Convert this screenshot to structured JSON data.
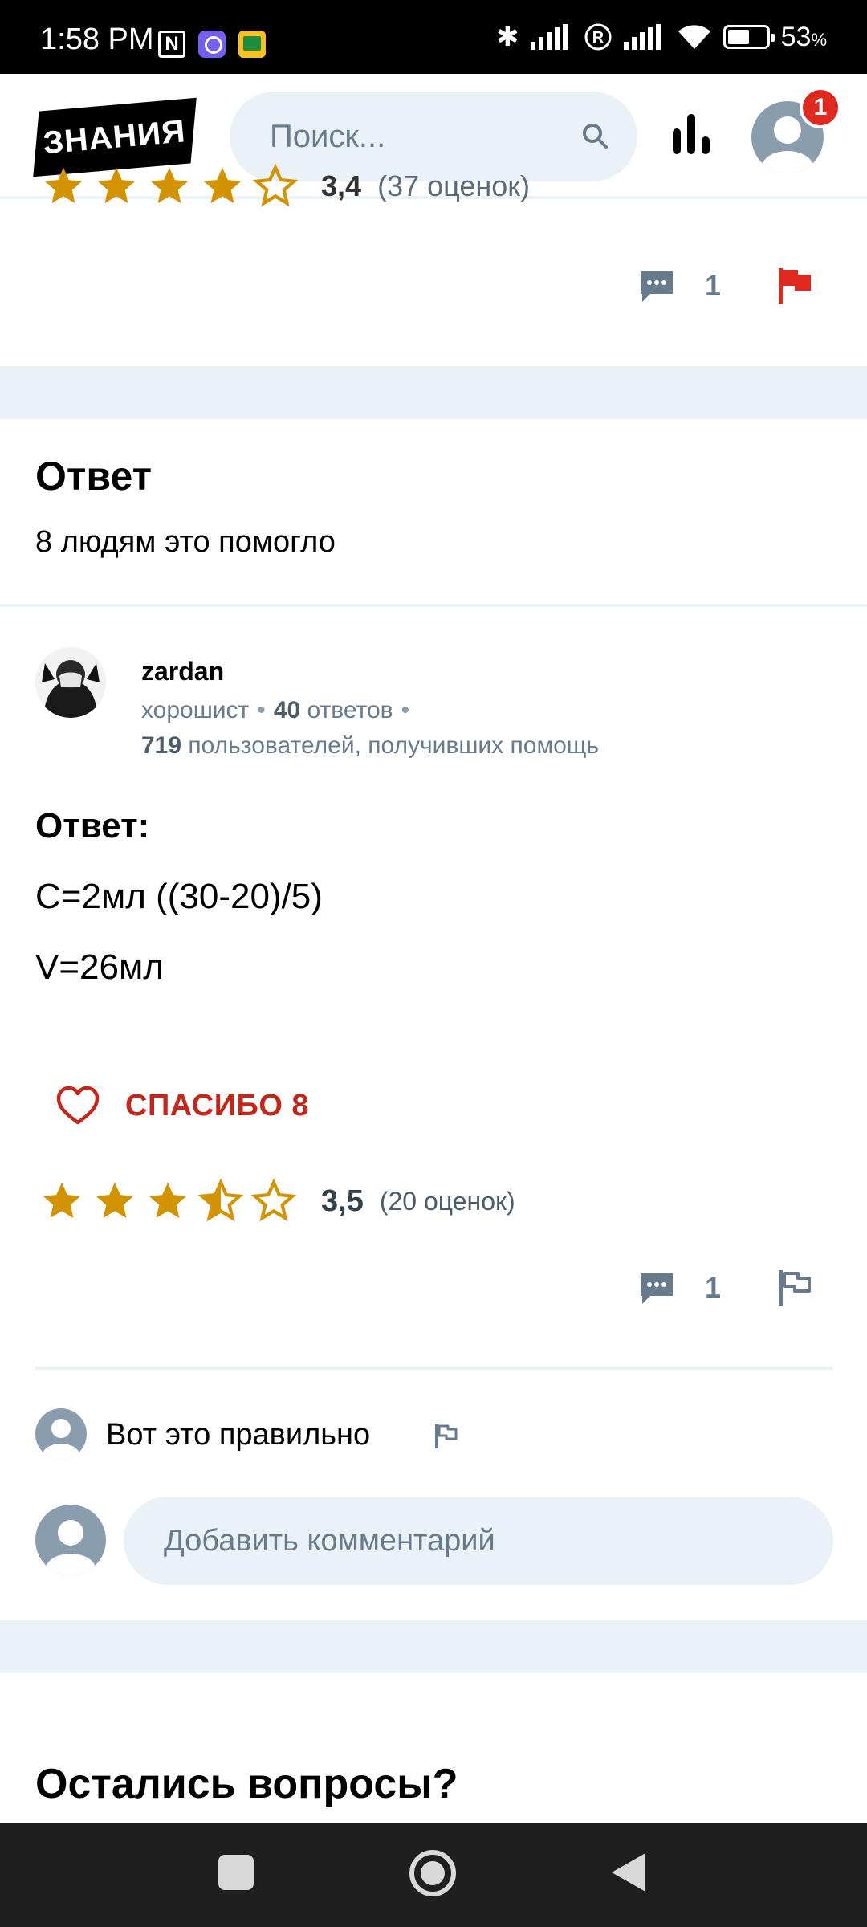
{
  "status_bar": {
    "time": "1:58 PM",
    "battery_percent": "53",
    "battery_percent_sign": "%"
  },
  "header": {
    "logo_text": "ЗНАНИЯ",
    "search_placeholder": "Поиск...",
    "notification_count": "1"
  },
  "question": {
    "rating_value": "3,4",
    "rating_count": "(37 оценок)",
    "comment_count": "1",
    "flag_color": "#e0291e"
  },
  "answer": {
    "section_title": "Ответ",
    "helped_text": "8 людям это помогло",
    "author": {
      "name": "zardan",
      "rank": "хорошист",
      "answers_count": "40",
      "answers_label": "ответов",
      "helped_users_count": "719",
      "helped_users_label": "пользователей, получивших помощь"
    },
    "content": {
      "heading": "Ответ:",
      "line1": "C=2мл ((30-20)/5)",
      "line2": "V=26мл"
    },
    "thanks_label": "СПАСИБО 8",
    "rating_value": "3,5",
    "rating_count": "(20 оценок)",
    "rating_stars": 3.5,
    "comment_count": "1",
    "star_color": "#d39200"
  },
  "comments": [
    {
      "text": "Вот это правильно"
    }
  ],
  "add_comment_placeholder": "Добавить комментарий",
  "footer_heading": "Остались вопросы?",
  "colors": {
    "accent_red": "#c3261b",
    "band_bg": "#ebf2f7",
    "muted_text": "#687b8c"
  }
}
